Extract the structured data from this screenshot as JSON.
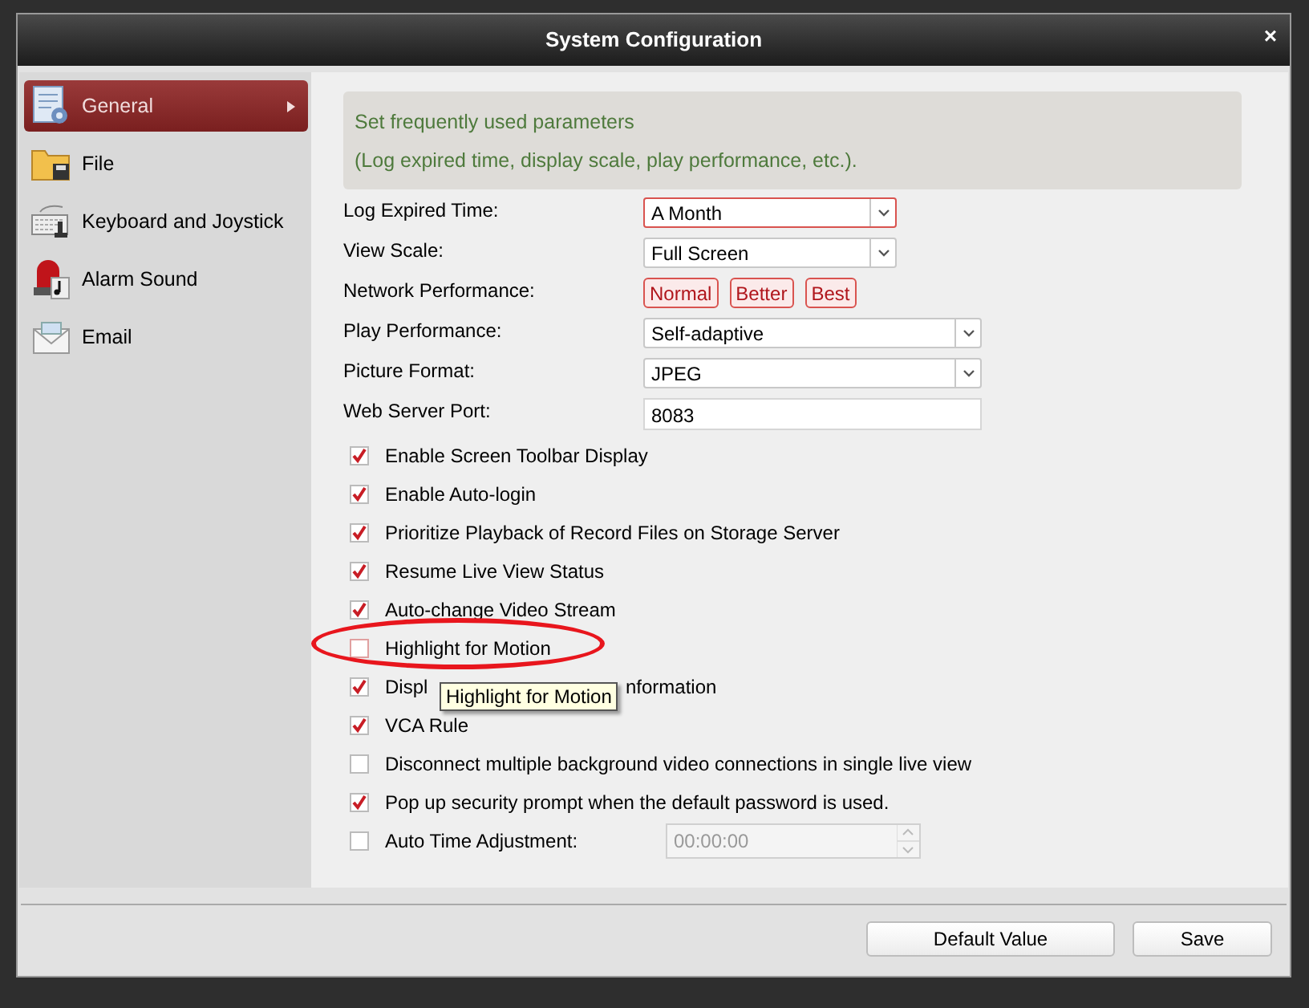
{
  "window": {
    "title": "System Configuration",
    "close": "×"
  },
  "sidebar": {
    "items": [
      {
        "label": "General",
        "selected": true
      },
      {
        "label": "File",
        "selected": false
      },
      {
        "label": "Keyboard and Joystick",
        "selected": false
      },
      {
        "label": "Alarm Sound",
        "selected": false
      },
      {
        "label": "Email",
        "selected": false
      }
    ]
  },
  "description": [
    "Set frequently used parameters",
    "(Log expired time, display scale, play performance, etc.)."
  ],
  "fields": [
    {
      "kind": "select",
      "label": "Log Expired Time:",
      "value": "A Month",
      "focused": true
    },
    {
      "kind": "select",
      "label": "View Scale:",
      "value": "Full Screen",
      "focused": false
    },
    {
      "kind": "buttons",
      "label": "Network Performance:",
      "options": [
        "Normal",
        "Better",
        "Best"
      ]
    },
    {
      "kind": "select",
      "label": "Play Performance:",
      "value": "Self-adaptive",
      "focused": false
    },
    {
      "kind": "select",
      "label": "Picture Format:",
      "value": "JPEG",
      "focused": false
    },
    {
      "kind": "input",
      "label": "Web Server Port:",
      "value": "8083"
    }
  ],
  "options": [
    {
      "kind": "checkbox",
      "label": "Enable Screen Toolbar Display",
      "checked": true,
      "circled": false
    },
    {
      "kind": "checkbox",
      "label": "Enable Auto-login",
      "checked": true,
      "circled": false
    },
    {
      "kind": "checkbox",
      "label": "Prioritize Playback of Record Files on Storage Server",
      "checked": true,
      "circled": false
    },
    {
      "kind": "checkbox",
      "label": "Resume Live View Status",
      "checked": true,
      "circled": false
    },
    {
      "kind": "checkbox",
      "label": "Auto-change Video Stream",
      "checked": true,
      "circled": false
    },
    {
      "kind": "checkbox",
      "label": "Highlight for Motion",
      "checked": false,
      "circled": true
    },
    {
      "kind": "covered",
      "label_parts": [
        "Displ",
        "nformation"
      ],
      "checked": true,
      "circled": false
    },
    {
      "kind": "checkbox",
      "label": "VCA Rule",
      "checked": true,
      "circled": false
    },
    {
      "kind": "checkbox",
      "label": "Disconnect multiple background video connections in single live view",
      "checked": false,
      "circled": false
    },
    {
      "kind": "checkbox",
      "label": "Pop up security prompt when the default password is used.",
      "checked": true,
      "circled": false
    },
    {
      "kind": "time",
      "label": "Auto Time Adjustment:",
      "checked": false,
      "circled": false,
      "value": "00:00:00"
    }
  ],
  "tooltip": {
    "text": "Highlight for Motion"
  },
  "buttons": [
    "Default Value",
    "Save"
  ]
}
